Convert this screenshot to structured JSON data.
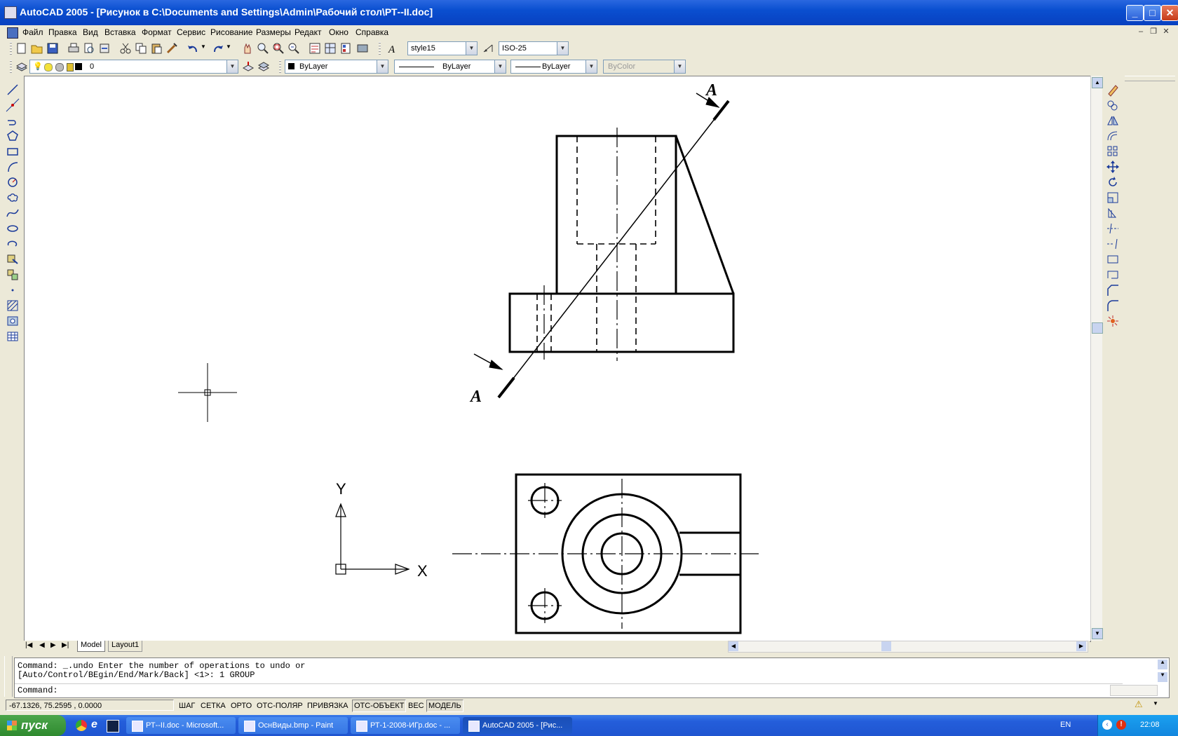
{
  "window": {
    "title": "AutoCAD 2005 - [Рисунок в C:\\Documents and Settings\\Admin\\Рабочий стол\\РТ--II.doc]",
    "minimize": "_",
    "maximize": "□",
    "close": "✕"
  },
  "menu": [
    "Файл",
    "Правка",
    "Вид",
    "Вставка",
    "Формат",
    "Сервис",
    "Рисование",
    "Размеры",
    "Редакт",
    "Окно",
    "Справка"
  ],
  "toolbars": {
    "text_style": "style15",
    "dim_style": "ISO-25",
    "layer": "0",
    "color": "ByLayer",
    "linetype": "ByLayer",
    "lineweight": "ByLayer",
    "plotstyle": "ByColor"
  },
  "drawing": {
    "section_label_top": "A",
    "section_label_bottom": "A",
    "ucs_x": "X",
    "ucs_y": "Y"
  },
  "layout_tabs": [
    "Model",
    "Layout1"
  ],
  "command_history": [
    "Command: _.undo Enter the number of operations to undo or",
    "[Auto/Control/BEgin/End/Mark/Back] <1>: 1 GROUP"
  ],
  "command_prompt": "Command:",
  "status": {
    "coords": "-67.1326, 75.2595 , 0.0000",
    "toggles": [
      "ШАГ",
      "СЕТКА",
      "ОРТО",
      "ОТС-ПОЛЯР",
      "ПРИВЯЗКА",
      "ОТС-ОБЪЕКТ",
      "ВЕС",
      "МОДЕЛЬ"
    ]
  },
  "taskbar": {
    "start": "пуск",
    "tasks": [
      "РТ--II.doc - Microsoft...",
      "ОснВиды.bmp - Paint",
      "РТ-1-2008-ИГр.doc - ...",
      "AutoCAD 2005 - [Рис..."
    ],
    "lang": "EN",
    "clock": "22:08"
  }
}
